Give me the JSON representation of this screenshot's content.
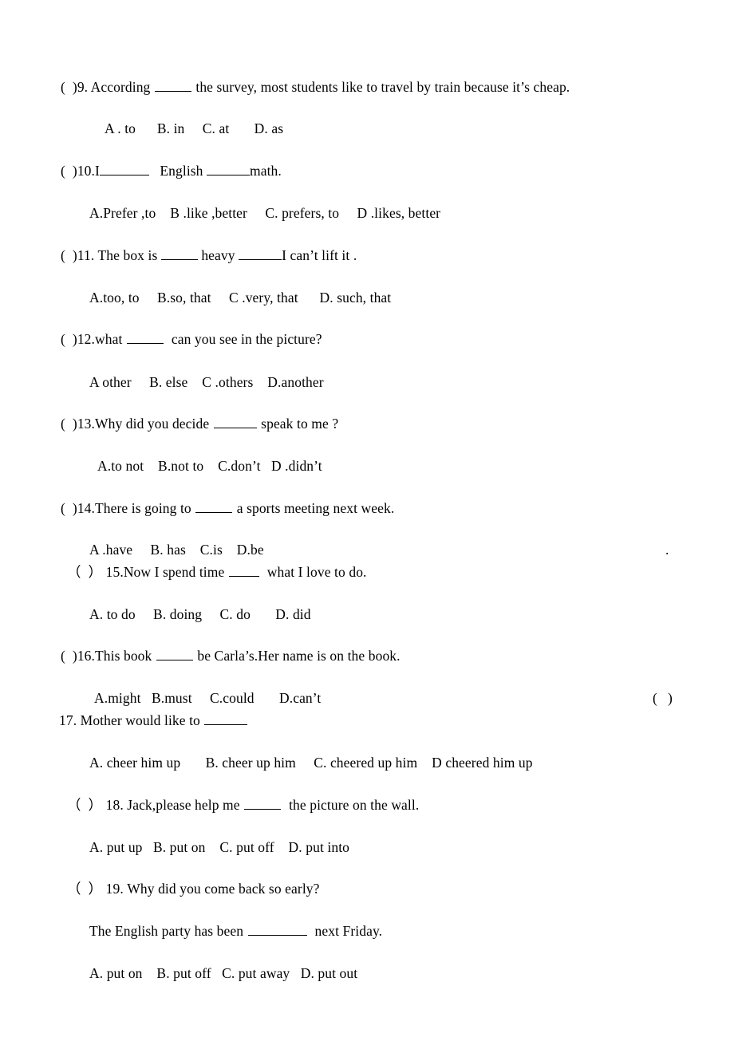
{
  "document": {
    "type": "english-grammar-multiple-choice-worksheet",
    "background_color": "#ffffff",
    "text_color": "#000000"
  },
  "questions": [
    {
      "bracket": "(  )",
      "number": "9.",
      "stem_before": " According ",
      "stem_after": " the survey, most students like to travel by train because it’s cheap.",
      "options": "A . to      B. in     C. at       D. as"
    },
    {
      "bracket": "(  )",
      "number": "10.",
      "stem_before": "I",
      "stem_mid": "   English ",
      "stem_after": "math.",
      "options": "A.Prefer ,to    B .like ,better     C. prefers, to     D .likes, better"
    },
    {
      "bracket": "(  )",
      "number": "11.",
      "stem_before": " The box is ",
      "stem_mid": " heavy ",
      "stem_after": "I can’t lift it .",
      "options": "A.too, to     B.so, that     C .very, that      D. such, that"
    },
    {
      "bracket": "(  )",
      "number": "12.",
      "stem_before": "what ",
      "stem_after": "  can you see in the picture?",
      "options": "A other     B. else    C .others    D.another"
    },
    {
      "bracket": "(  )",
      "number": "13.",
      "stem_before": "Why did you decide ",
      "stem_after": " speak to me ?",
      "options": "A.to not    B.not to    C.don’t   D .didn’t"
    },
    {
      "bracket": "(  )",
      "number": "14.",
      "stem_before": "There is going to ",
      "stem_after": " a sports meeting next week.",
      "options": "A .have     B. has    C.is    D.be"
    },
    {
      "bracket": "（  ）",
      "number": " 15.",
      "stem_before": "Now I spend time ",
      "stem_after": "  what I love to do.",
      "options": "A. to do     B. doing     C. do       D. did"
    },
    {
      "bracket": "(  )",
      "number": "16.",
      "stem_before": "This book ",
      "stem_after": " be Carla’s.Her name is on the book.",
      "options": "A.might   B.must     C.could       D.can’t"
    },
    {
      "bracket": "",
      "number": "17.",
      "stem_before": " Mother would like to ",
      "stem_after": "",
      "options": "A. cheer him up       B. cheer up him     C. cheered up him    D cheered him up"
    },
    {
      "bracket": "（  ）",
      "number": " 18.",
      "stem_before": " Jack,please help me ",
      "stem_after": "  the picture on the wall.",
      "options": "A. put up   B. put on    C. put off    D. put into"
    },
    {
      "bracket": "（  ）",
      "number": " 19.",
      "stem_before": " Why did you come back so early?",
      "stem_after": "",
      "sub_line_before": "The English party has been ",
      "sub_line_after": "  next Friday.",
      "options": "A. put on    B. put off   C. put away   D. put out"
    }
  ],
  "stray_marks": {
    "period_after_q14_options": ".",
    "orphan_bracket_after_q16_options": "(   )"
  }
}
